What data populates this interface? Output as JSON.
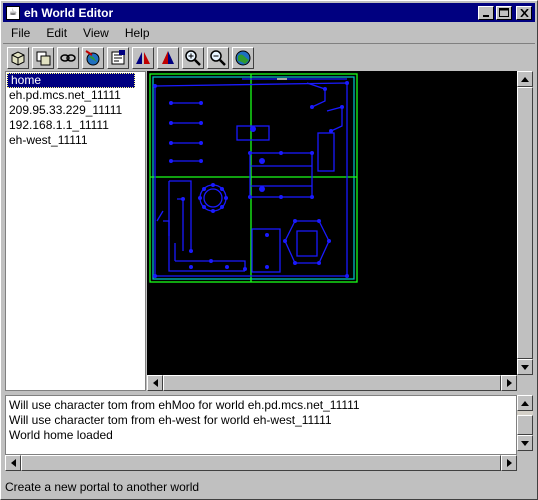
{
  "window": {
    "title": "eh World Editor",
    "app_icon": "java-cup-icon",
    "controls": {
      "minimize": "_",
      "maximize": "□",
      "close": "×"
    }
  },
  "menubar": {
    "items": [
      {
        "label": "File"
      },
      {
        "label": "Edit"
      },
      {
        "label": "View"
      },
      {
        "label": "Help"
      }
    ]
  },
  "toolbar": {
    "buttons": [
      {
        "icon": "box-3d-icon"
      },
      {
        "icon": "room-icon"
      },
      {
        "icon": "link-chain-icon"
      },
      {
        "icon": "globe-arrow-icon"
      },
      {
        "icon": "properties-icon"
      },
      {
        "icon": "flip-horizontal-icon"
      },
      {
        "icon": "flip-vertical-icon"
      },
      {
        "icon": "zoom-in-icon"
      },
      {
        "icon": "zoom-out-icon"
      },
      {
        "icon": "world-icon"
      }
    ]
  },
  "sidebar": {
    "items": [
      {
        "label": "home",
        "selected": true
      },
      {
        "label": "eh.pd.mcs.net_11111"
      },
      {
        "label": "209.95.33.229_11111"
      },
      {
        "label": "192.168.1.1_11111"
      },
      {
        "label": "eh-west_11111"
      }
    ]
  },
  "log": {
    "lines": [
      "Will use character tom from ehMoo for world eh.pd.mcs.net_11111",
      "Will use character tom from eh-west for world eh-west_11111",
      "World home loaded"
    ]
  },
  "status": {
    "text": "Create a new portal to another world"
  },
  "colors": {
    "title_bar": "#000080",
    "map_lines": "#1a1aff",
    "map_frame": "#1aff1a",
    "map_accent": "#00bcbc"
  }
}
